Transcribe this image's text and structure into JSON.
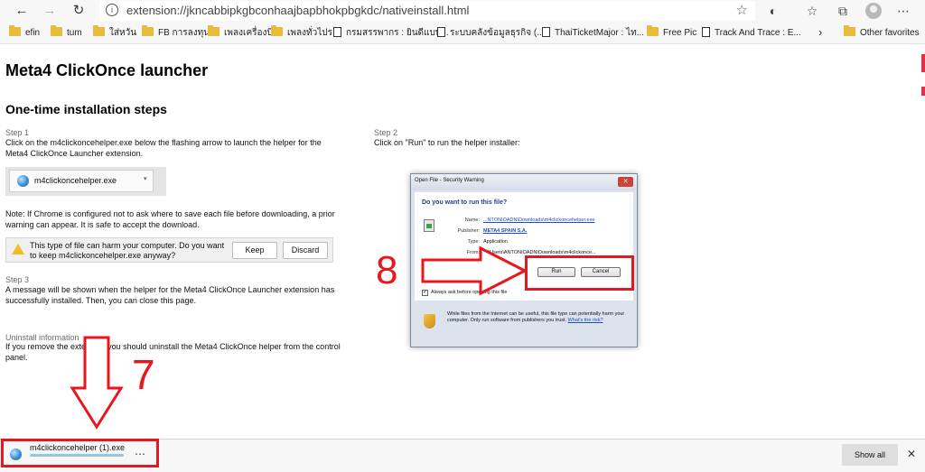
{
  "browser": {
    "nav": {
      "back": "←",
      "forward": "→",
      "reload": "↻"
    },
    "url_info_icon": "i",
    "url": "extension://jkncabbipkgbconhaajbapbhokpbgkdc/nativeinstall.html",
    "star": "☆",
    "toolbar_icons": [
      "extension-icon",
      "favorites-icon",
      "collections-icon",
      "profile-avatar",
      "more-icon"
    ],
    "toolbar_glyphs": {
      "extension": "◐",
      "favorites": "☆",
      "collections": "⧉",
      "more": "⋯"
    }
  },
  "bookmarks": [
    {
      "label": "efin",
      "type": "folder"
    },
    {
      "label": "tum",
      "type": "folder"
    },
    {
      "label": "ใส่หวัน",
      "type": "folder"
    },
    {
      "label": "FB การลงทุน",
      "type": "folder"
    },
    {
      "label": "เพลงเครื่องบิน",
      "type": "folder"
    },
    {
      "label": "เพลงทั่วไปร",
      "type": "folder"
    },
    {
      "label": "กรมสรรพากร : ยินดีแบบ...",
      "type": "page"
    },
    {
      "label": "ระบบคลังข้อมูลธุรกิจ (...",
      "type": "page"
    },
    {
      "label": "ThaiTicketMajor : ไท...",
      "type": "page"
    },
    {
      "label": "Free Pic",
      "type": "folder"
    },
    {
      "label": "Track And Trace : E...",
      "type": "page"
    },
    {
      "label": "Other favorites",
      "type": "folder"
    }
  ],
  "bookmarks_more": "›",
  "page": {
    "title": "Meta4 ClickOnce launcher",
    "section_title": "One-time installation steps",
    "step1": {
      "label": "Step 1",
      "text": "Click on the m4clickoncehelper.exe below the flashing arrow to launch the helper for the Meta4 ClickOnce Launcher extension."
    },
    "file_button": {
      "label": "m4clickoncehelper.exe",
      "caret": "▾"
    },
    "note": "Note: If Chrome is configured not to ask where to save each file before downloading, a prior warning can appear. It is safe to accept the download.",
    "warning_bar": {
      "text": "This type of file can harm your computer. Do you want to keep m4clickoncehelper.exe anyway?",
      "keep": "Keep",
      "discard": "Discard"
    },
    "step3": {
      "label": "Step 3",
      "text": "A message will be shown when the helper for the Meta4 ClickOnce Launcher extension has successfully installed. Then, you can close this page."
    },
    "uninstall": {
      "label": "Uninstall information",
      "text": "If you remove the extension you should uninstall the Meta4 ClickOnce helper from the control panel."
    },
    "step2": {
      "label": "Step 2",
      "text": "Click on \"Run\" to run the helper installer:"
    }
  },
  "dialog": {
    "title": "Open File - Security Warning",
    "close": "✕",
    "question": "Do you want to run this file?",
    "fields": [
      {
        "key": "Name:",
        "value": "...NTONIOADN\\Downloads\\m4clickoncehelper.exe",
        "link": true
      },
      {
        "key": "Publisher:",
        "value": "META4 SPAIN S.A.",
        "link": true
      },
      {
        "key": "Type:",
        "value": "Application",
        "link": false
      },
      {
        "key": "From:",
        "value": "C:\\Users\\ANTONIOADN\\Downloads\\m4clickonce...",
        "link": false
      }
    ],
    "run": "Run",
    "cancel": "Cancel",
    "checkbox_mark": "✓",
    "checkbox_label": "Always ask before opening this file",
    "footer_text": "While files from the Internet can be useful, this file type can potentially harm your computer. Only run software from publishers you trust.",
    "footer_link": "What's the risk?"
  },
  "annotations": {
    "step_8": "8",
    "step_7": "7",
    "color": "#e8161e"
  },
  "download_shelf": {
    "file_name": "m4clickoncehelper (1).exe",
    "progress": 1.0,
    "menu": "⋯",
    "show_all": "Show all",
    "close": "✕"
  }
}
